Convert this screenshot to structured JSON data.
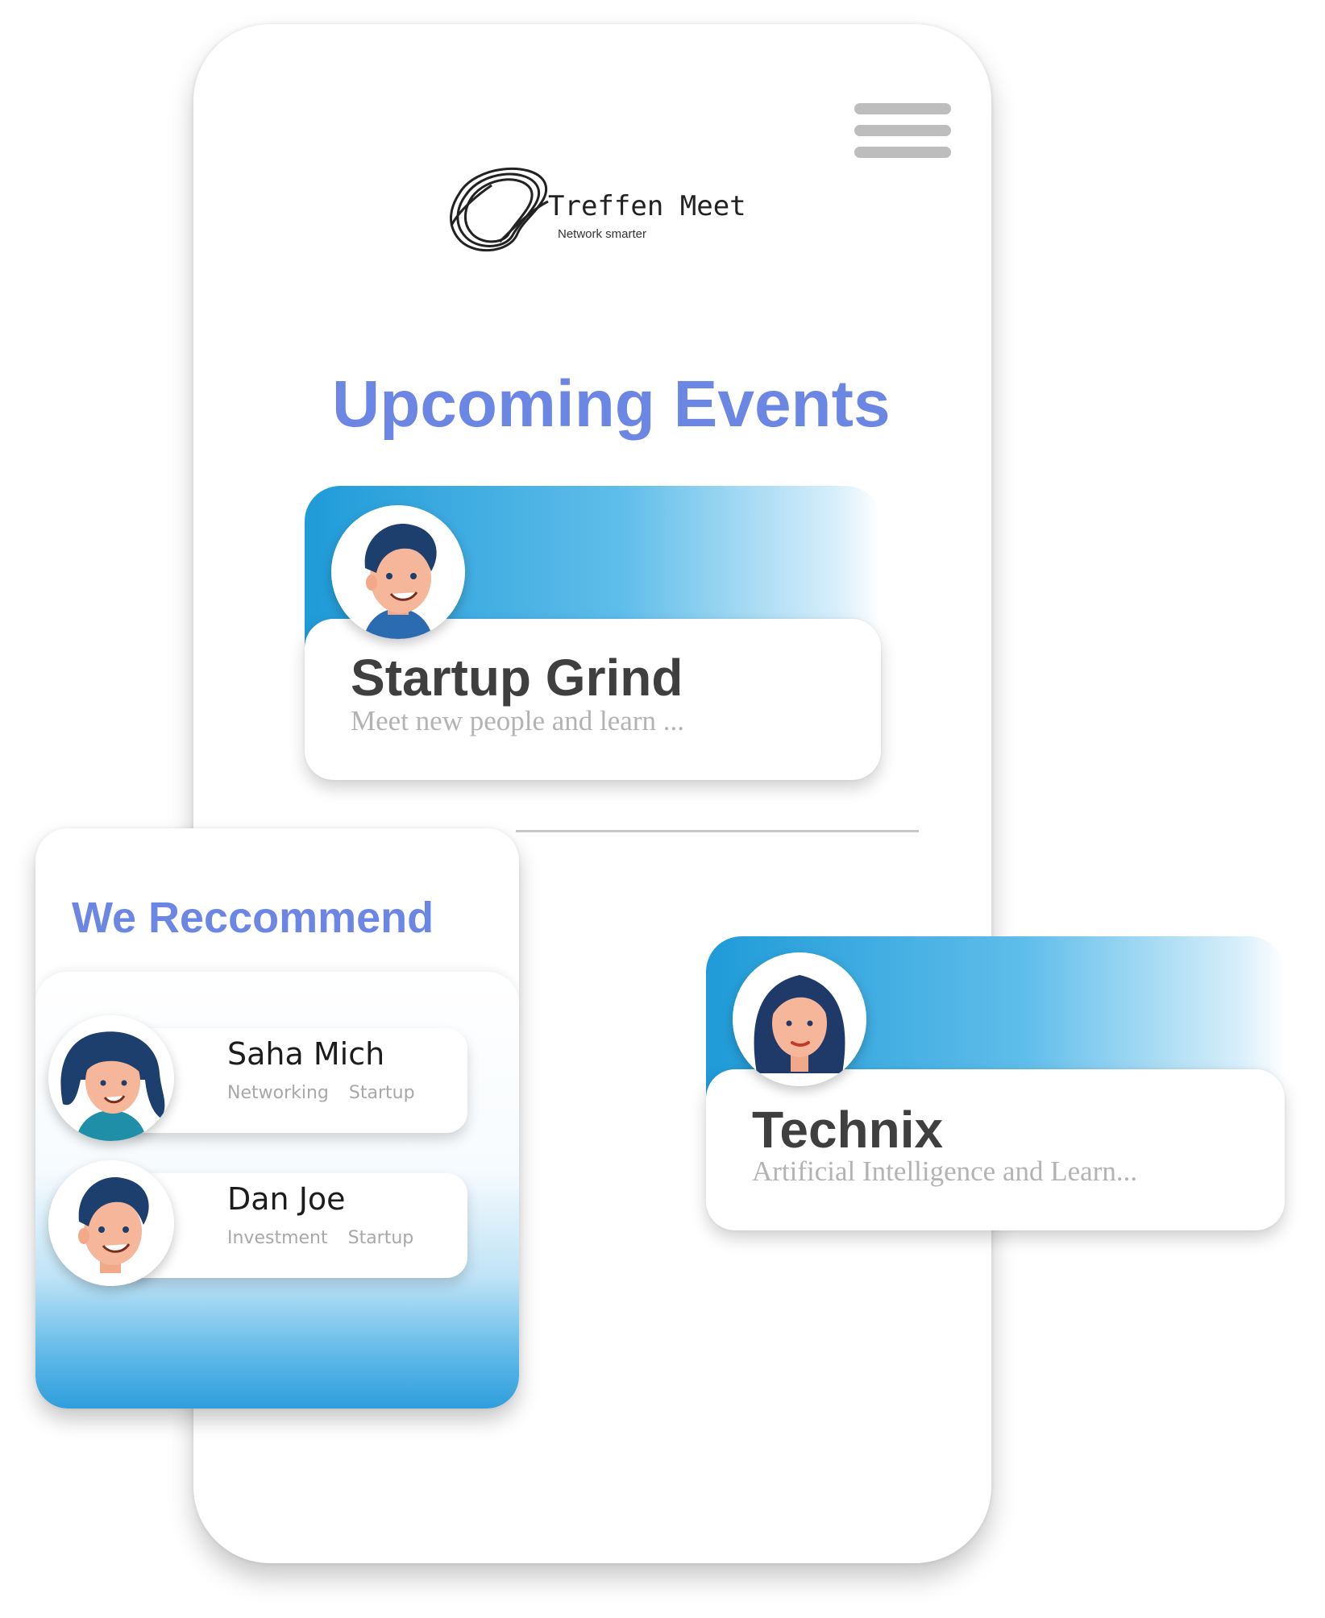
{
  "app": {
    "logo_name": "Treffen Meet",
    "logo_tagline": "Network smarter",
    "menu_icon": "hamburger-menu-icon"
  },
  "upcoming": {
    "title": "Upcoming Events",
    "events": [
      {
        "title": "Startup Grind",
        "description": "Meet new people and learn ...",
        "avatar_icon": "man-avatar-icon"
      },
      {
        "title": "Technix",
        "description": "Artificial  Intelligence and Learn...",
        "avatar_icon": "woman-avatar-icon"
      }
    ]
  },
  "recommend": {
    "title": "We Reccommend",
    "people": [
      {
        "name": "Saha Mich",
        "tags": [
          "Networking",
          "Startup"
        ],
        "avatar_icon": "woman-avatar-icon"
      },
      {
        "name": "Dan Joe",
        "tags": [
          "Investment",
          "Startup"
        ],
        "avatar_icon": "man-avatar-icon"
      }
    ]
  },
  "colors": {
    "accent_title": "#6b86e3",
    "band_blue": "#1f9bd8",
    "hair_navy": "#1c3f6e",
    "skin": "#f6b69a"
  }
}
